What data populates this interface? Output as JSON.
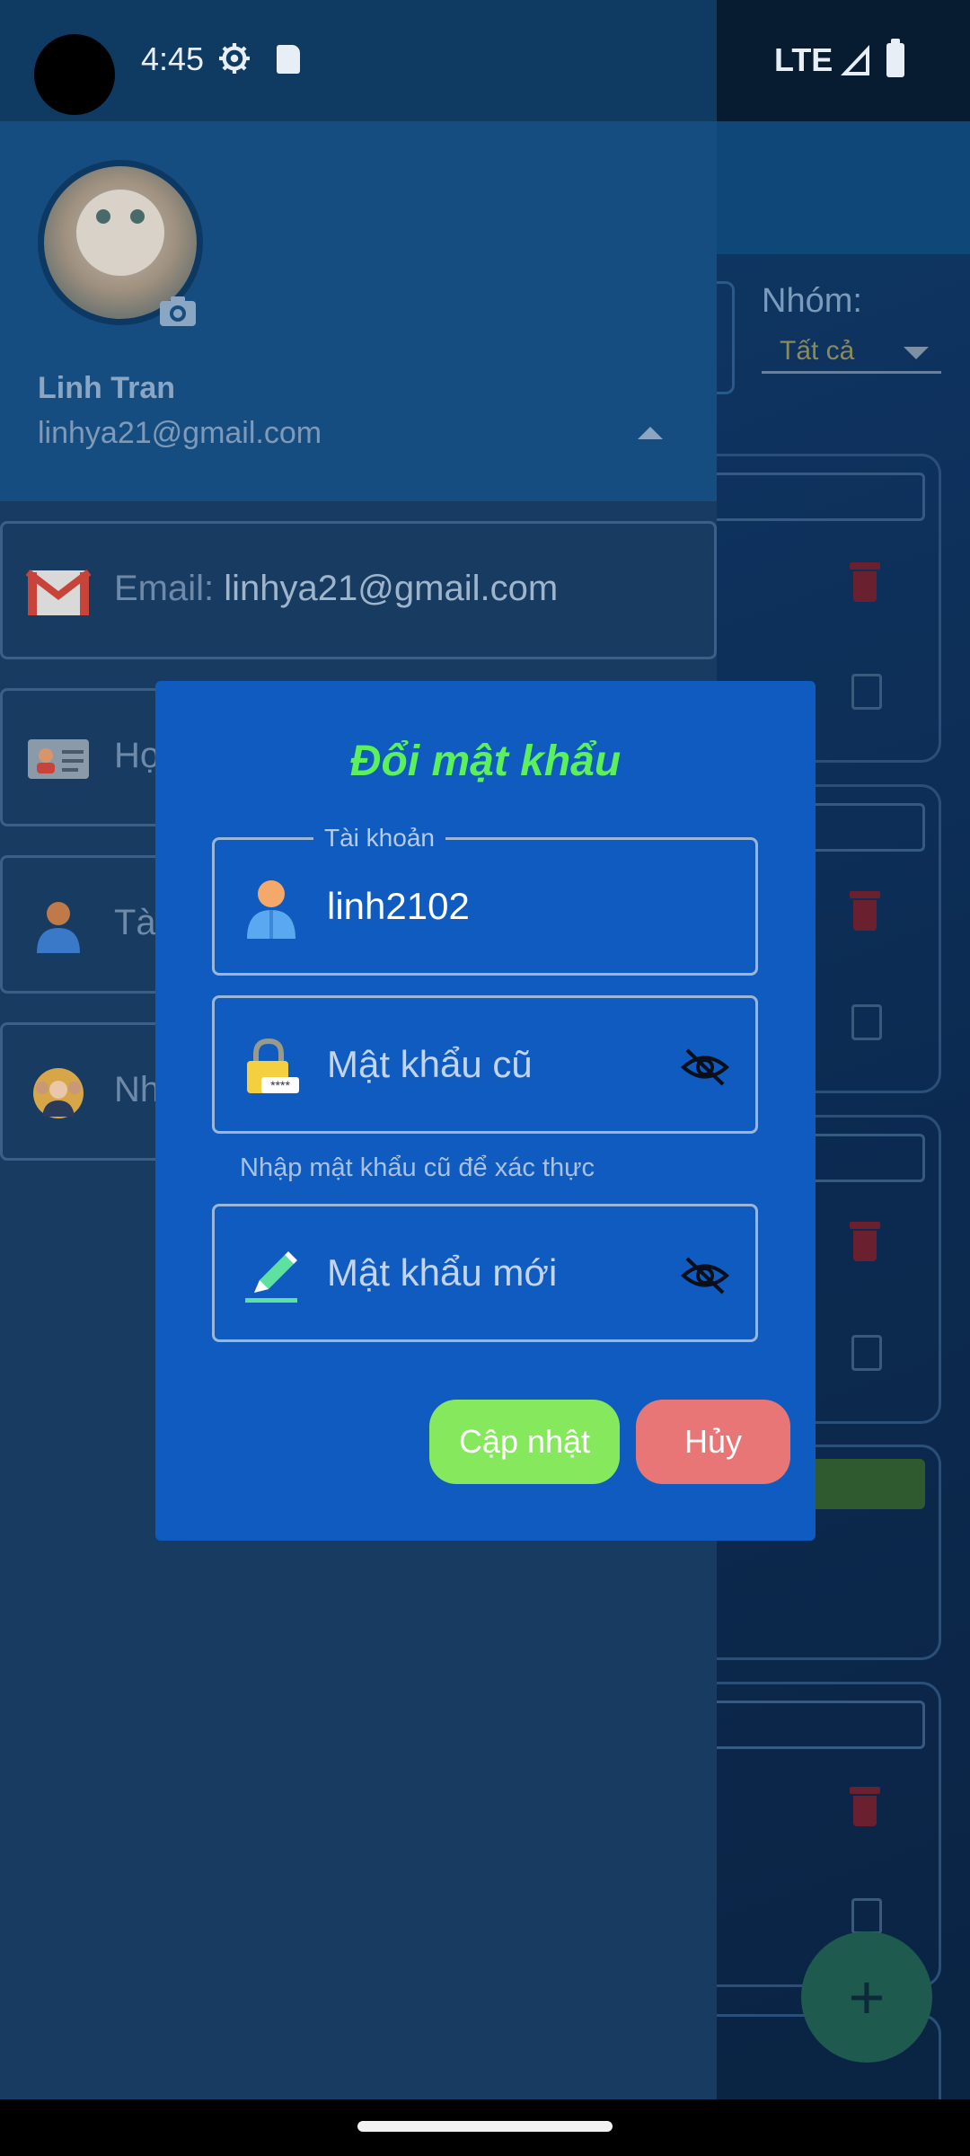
{
  "status_bar": {
    "time": "4:45",
    "network": "LTE",
    "icons": [
      "settings-icon",
      "sd-card-icon",
      "signal-icon",
      "battery-icon"
    ]
  },
  "background": {
    "group_label": "Nhóm:",
    "group_value": "Tất cả"
  },
  "drawer": {
    "user_name": "Linh Tran",
    "user_email": "linhya21@gmail.com",
    "items": [
      {
        "icon": "gmail-icon",
        "label": "Email:",
        "value": "linhya21@gmail.com"
      },
      {
        "icon": "id-card-icon",
        "label": "Họ",
        "value": ""
      },
      {
        "icon": "person-icon",
        "label": "Tà",
        "value": ""
      },
      {
        "icon": "group-icon",
        "label": "Nh",
        "value": ""
      }
    ]
  },
  "dialog": {
    "title": "Đổi mật khẩu",
    "account_legend": "Tài khoản",
    "account_value": "linh2102",
    "old_password_placeholder": "Mật khẩu cũ",
    "old_password_helper": "Nhập mật khẩu cũ để xác thực",
    "new_password_placeholder": "Mật khẩu mới",
    "update_button": "Cập nhật",
    "cancel_button": "Hủy"
  },
  "colors": {
    "dialog_bg": "#0f5bbf",
    "title_green": "#5cf05a",
    "update_btn": "#86e85c",
    "cancel_btn": "#e87676",
    "drawer_header": "#164d80"
  }
}
